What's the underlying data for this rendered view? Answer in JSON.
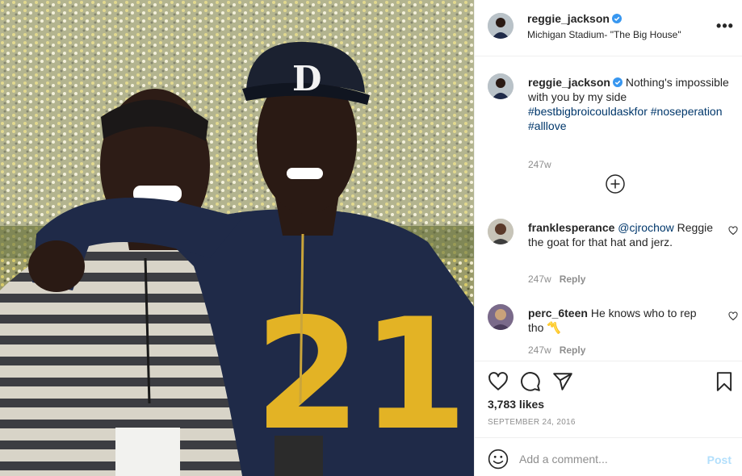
{
  "post": {
    "image_alt": "Two men smiling in Michigan Stadium",
    "jersey_number": "21",
    "cap_logo": "D"
  },
  "header": {
    "username": "reggie_jackson",
    "location": "Michigan Stadium- \"The Big House\"",
    "more_label": "•••"
  },
  "caption": {
    "username": "reggie_jackson",
    "text": "Nothing's impossible with you by my side",
    "hashtags": [
      "#bestbigbroicouldaskfor",
      "#noseperation",
      "#alllove"
    ],
    "time": "247w"
  },
  "comments": [
    {
      "username": "franklesperance",
      "mention": "@cjrochow",
      "text": "Reggie the goat for that hat and jerz.",
      "time": "247w",
      "reply": "Reply"
    },
    {
      "username": "perc_6teen",
      "mention": "",
      "text": "He knows who to rep tho 〽️",
      "time": "247w",
      "reply": "Reply"
    }
  ],
  "actions": {
    "likes": "3,783 likes",
    "date": "SEPTEMBER 24, 2016"
  },
  "add_comment": {
    "placeholder": "Add a comment...",
    "post_label": "Post"
  },
  "colors": {
    "link": "#00376b",
    "verified": "#3897f0",
    "muted": "#8e8e8e",
    "post_disabled": "#b2dffc",
    "jersey_navy": "#1f2a48",
    "jersey_maize": "#e3b325"
  },
  "icons": [
    "more-icon",
    "verified-badge-icon",
    "load-more-icon",
    "heart-icon",
    "comment-icon",
    "share-icon",
    "bookmark-icon",
    "emoji-icon"
  ]
}
